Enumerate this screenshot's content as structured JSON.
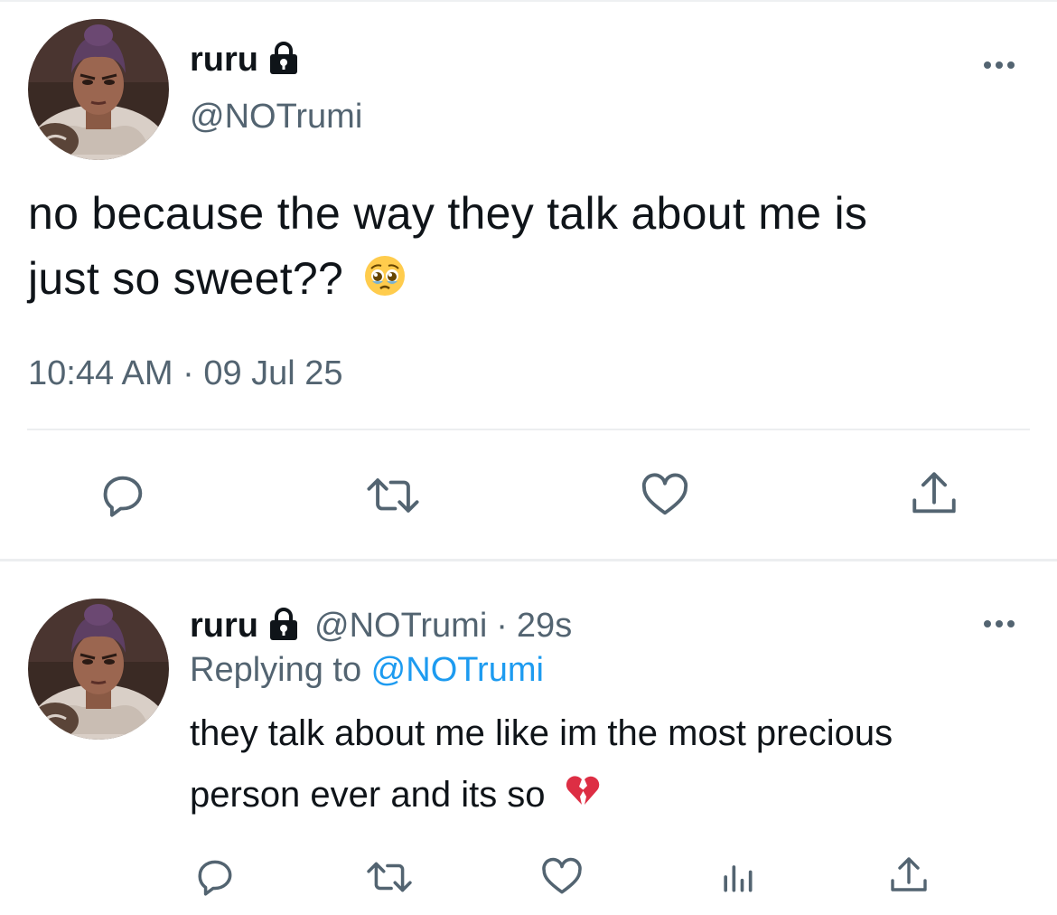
{
  "tweet": {
    "display_name": "ruru",
    "handle": "@NOTrumi",
    "text_line1": "no because the way they talk about me is",
    "text_line2": "just so sweet??",
    "emoji": "pleading-face",
    "timestamp": "10:44 AM · 09 Jul 25",
    "actions": [
      "reply-icon",
      "retweet-icon",
      "like-icon",
      "share-icon"
    ]
  },
  "reply": {
    "display_name": "ruru",
    "handle": "@NOTrumi",
    "separator": "·",
    "age": "29s",
    "replying_label": "Replying to ",
    "replying_handle": "@NOTrumi",
    "text_line1": "they talk about me like im the most precious",
    "text_line2": "person ever and its so",
    "emoji": "broken-heart",
    "actions": [
      "reply-icon",
      "retweet-icon",
      "like-icon",
      "analytics-icon",
      "share-icon"
    ]
  },
  "colors": {
    "text": "#0f1419",
    "secondary": "#536471",
    "accent": "#1d9bf0",
    "divider": "#eceef0"
  }
}
